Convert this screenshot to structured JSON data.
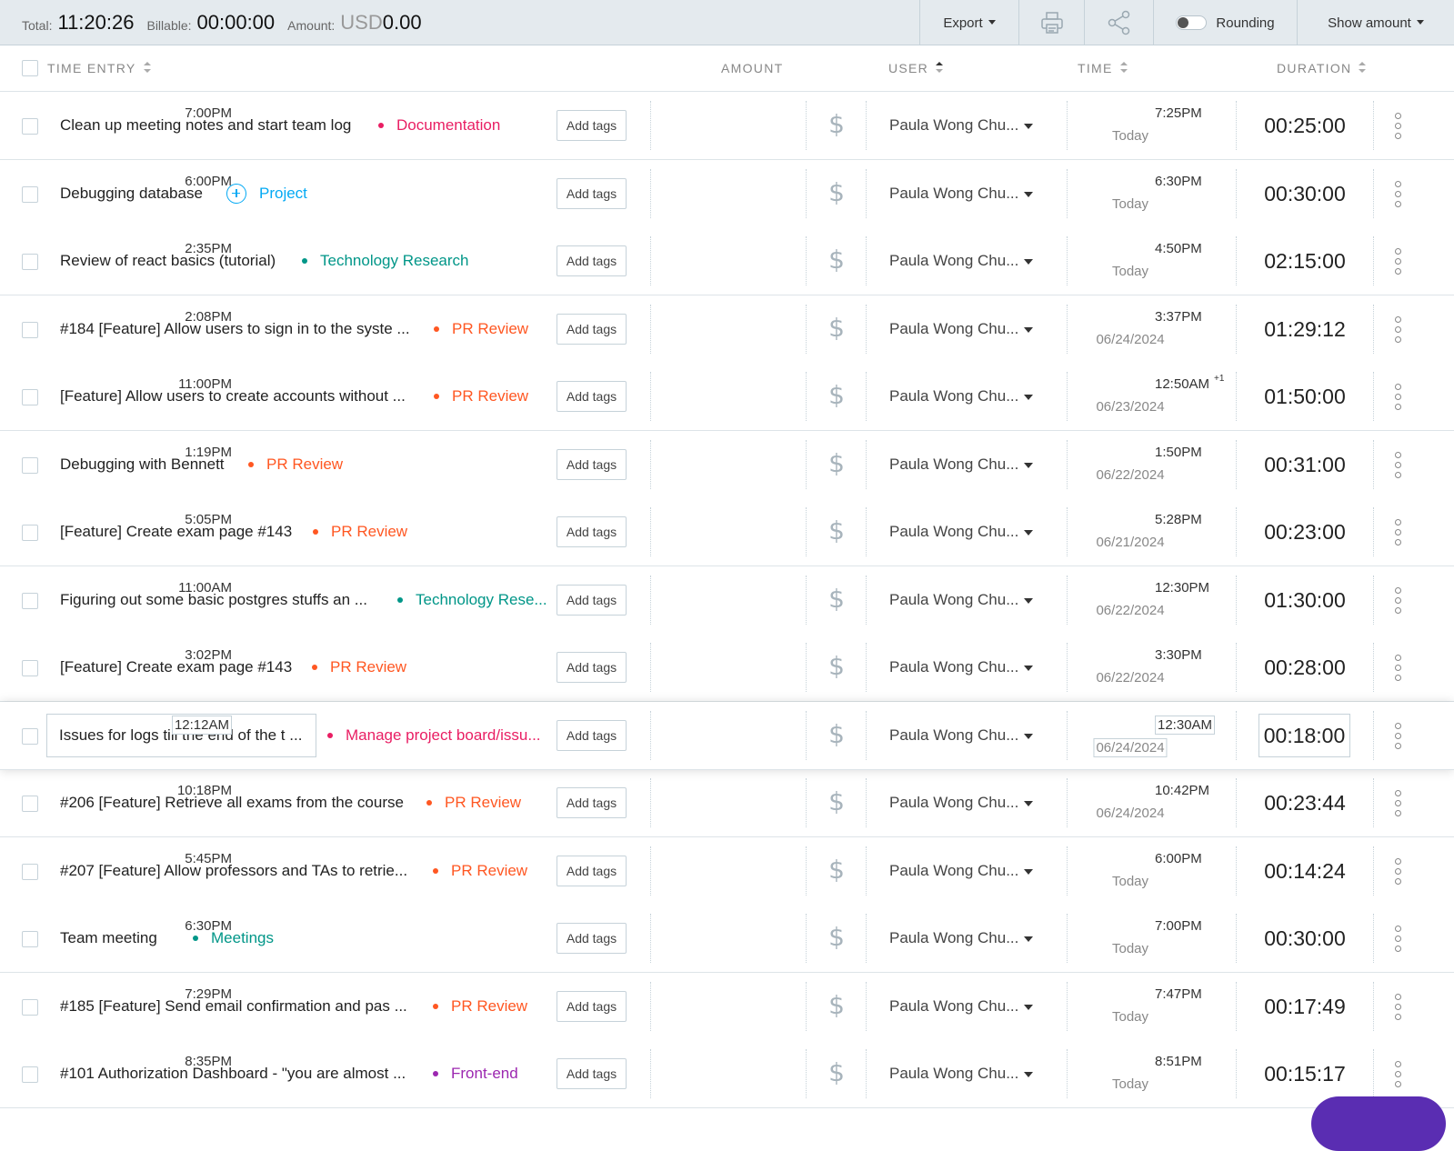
{
  "summary": {
    "total_label": "Total:",
    "total_value": "11:20:26",
    "billable_label": "Billable:",
    "billable_value": "00:00:00",
    "amount_label": "Amount:",
    "amount_currency": "USD",
    "amount_value": "0.00"
  },
  "toolbar": {
    "export_label": "Export",
    "print_icon": "printer-icon",
    "share_icon": "share-icon",
    "rounding_label": "Rounding",
    "rounding_on": false,
    "show_amount_label": "Show amount"
  },
  "columns": {
    "time_entry": "TIME ENTRY",
    "amount": "AMOUNT",
    "user": "USER",
    "time": "TIME",
    "duration": "DURATION"
  },
  "add_tags_label": "Add tags",
  "rows": [
    {
      "description": "Clean up meeting notes and start team log",
      "project": "Documentation",
      "project_color": "#e91e63",
      "user": "Paula Wong Chu...",
      "start": "7:00PM",
      "end": "7:25PM",
      "date": "Today",
      "duration": "00:25:00"
    },
    {
      "description": "Debugging database",
      "project": "Project",
      "project_color": "#03a9f4",
      "user": "Paula Wong Chu...",
      "start": "6:00PM",
      "end": "6:30PM",
      "date": "Today",
      "duration": "00:30:00"
    },
    {
      "description": "Review of react basics (tutorial)",
      "project": "Technology Research",
      "project_color": "#009688",
      "user": "Paula Wong Chu...",
      "start": "2:35PM",
      "end": "4:50PM",
      "date": "Today",
      "duration": "02:15:00"
    },
    {
      "description": "#184 [Feature] Allow users to sign in to the syste ...",
      "project": "PR Review",
      "project_color": "#ff5722",
      "user": "Paula Wong Chu...",
      "start": "2:08PM",
      "end": "3:37PM",
      "date": "06/24/2024",
      "duration": "01:29:12"
    },
    {
      "description": "[Feature] Allow users to create accounts without ...",
      "project": "PR Review",
      "project_color": "#ff5722",
      "user": "Paula Wong Chu...",
      "start": "11:00PM",
      "end": "12:50AM",
      "extra_day": "+1",
      "date": "06/23/2024",
      "duration": "01:50:00"
    },
    {
      "description": "Debugging with Bennett",
      "project": "PR Review",
      "project_color": "#ff5722",
      "user": "Paula Wong Chu...",
      "start": "1:19PM",
      "end": "1:50PM",
      "date": "06/22/2024",
      "duration": "00:31:00"
    },
    {
      "description": "[Feature] Create exam page #143",
      "project": "PR Review",
      "project_color": "#ff5722",
      "user": "Paula Wong Chu...",
      "start": "5:05PM",
      "end": "5:28PM",
      "date": "06/21/2024",
      "duration": "00:23:00"
    },
    {
      "description": "Figuring out some basic postgres stuffs an ...",
      "project": "Technology Rese...",
      "project_color": "#009688",
      "user": "Paula Wong Chu...",
      "start": "11:00AM",
      "end": "12:30PM",
      "date": "06/22/2024",
      "duration": "01:30:00"
    },
    {
      "description": "[Feature] Create exam page #143",
      "project": "PR Review",
      "project_color": "#ff5722",
      "user": "Paula Wong Chu...",
      "start": "3:02PM",
      "end": "3:30PM",
      "date": "06/22/2024",
      "duration": "00:28:00"
    },
    {
      "description": "Issues for logs till the end of the t ...",
      "project": "Manage project board/issu...",
      "project_color": "#e91e63",
      "user": "Paula Wong Chu...",
      "start": "12:12AM",
      "end": "12:30AM",
      "date": "06/24/2024",
      "duration": "00:18:00",
      "highlighted": true
    },
    {
      "description": "#206 [Feature] Retrieve all exams from the course",
      "project": "PR Review",
      "project_color": "#ff5722",
      "user": "Paula Wong Chu...",
      "start": "10:18PM",
      "end": "10:42PM",
      "date": "06/24/2024",
      "duration": "00:23:44"
    },
    {
      "description": "#207 [Feature] Allow professors and TAs to retrie...",
      "project": "PR Review",
      "project_color": "#ff5722",
      "user": "Paula Wong Chu...",
      "start": "5:45PM",
      "end": "6:00PM",
      "date": "Today",
      "duration": "00:14:24"
    },
    {
      "description": "Team meeting",
      "project": "Meetings",
      "project_color": "#009688",
      "user": "Paula Wong Chu...",
      "start": "6:30PM",
      "end": "7:00PM",
      "date": "Today",
      "duration": "00:30:00"
    },
    {
      "description": "#185 [Feature] Send email confirmation and pas ...",
      "project": "PR Review",
      "project_color": "#ff5722",
      "user": "Paula Wong Chu...",
      "start": "7:29PM",
      "end": "7:47PM",
      "date": "Today",
      "duration": "00:17:49"
    },
    {
      "description": "#101 Authorization Dashboard - \"you are almost ...",
      "project": "Front-end",
      "project_color": "#9c27b0",
      "user": "Paula Wong Chu...",
      "start": "8:35PM",
      "end": "8:51PM",
      "date": "Today",
      "duration": "00:15:17"
    }
  ]
}
